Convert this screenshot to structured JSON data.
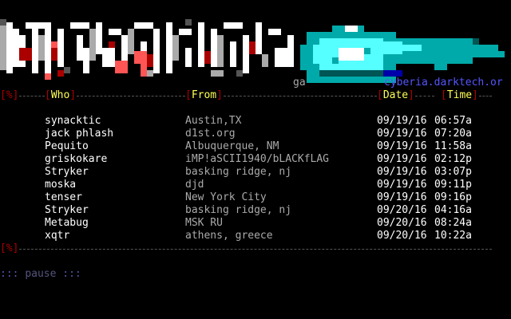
{
  "banner": {
    "tag": "ga",
    "url": "cyberia.darktech.or"
  },
  "header": {
    "corner": "%",
    "col_who": "Who",
    "col_from": "From",
    "col_date": "Date",
    "col_time": "Time"
  },
  "rows": [
    {
      "who": "synacktic",
      "from": "Austin,TX",
      "date": "09/19/16",
      "time": "06:57a"
    },
    {
      "who": "jack phlash",
      "from": "d1st.org",
      "date": "09/19/16",
      "time": "07:20a"
    },
    {
      "who": "Pequito",
      "from": "Albuquerque, NM",
      "date": "09/19/16",
      "time": "11:58a"
    },
    {
      "who": "griskokare",
      "from": "iMP!aSCII1940/bLACKfLAG",
      "date": "09/19/16",
      "time": "02:12p"
    },
    {
      "who": "Stryker",
      "from": "basking ridge, nj",
      "date": "09/19/16",
      "time": "03:07p"
    },
    {
      "who": "moska",
      "from": "djd",
      "date": "09/19/16",
      "time": "09:11p"
    },
    {
      "who": "tenser",
      "from": "New York City",
      "date": "09/19/16",
      "time": "09:16p"
    },
    {
      "who": "Stryker",
      "from": "basking ridge, nj",
      "date": "09/20/16",
      "time": "04:16a"
    },
    {
      "who": "Metabug",
      "from": "MSK RU",
      "date": "09/20/16",
      "time": "08:24a"
    },
    {
      "who": "xqtr",
      "from": "athens, greece",
      "date": "09/20/16",
      "time": "10:22a"
    }
  ],
  "footer": {
    "corner": "%"
  },
  "prompt": {
    "dots_left": ":::",
    "label": "pause",
    "dots_right": ":::"
  },
  "colors": {
    "red": "#aa0000",
    "yellow": "#ffff55",
    "cyan": "#55ffff",
    "teal": "#00aaaa",
    "blue": "#5555ff"
  }
}
